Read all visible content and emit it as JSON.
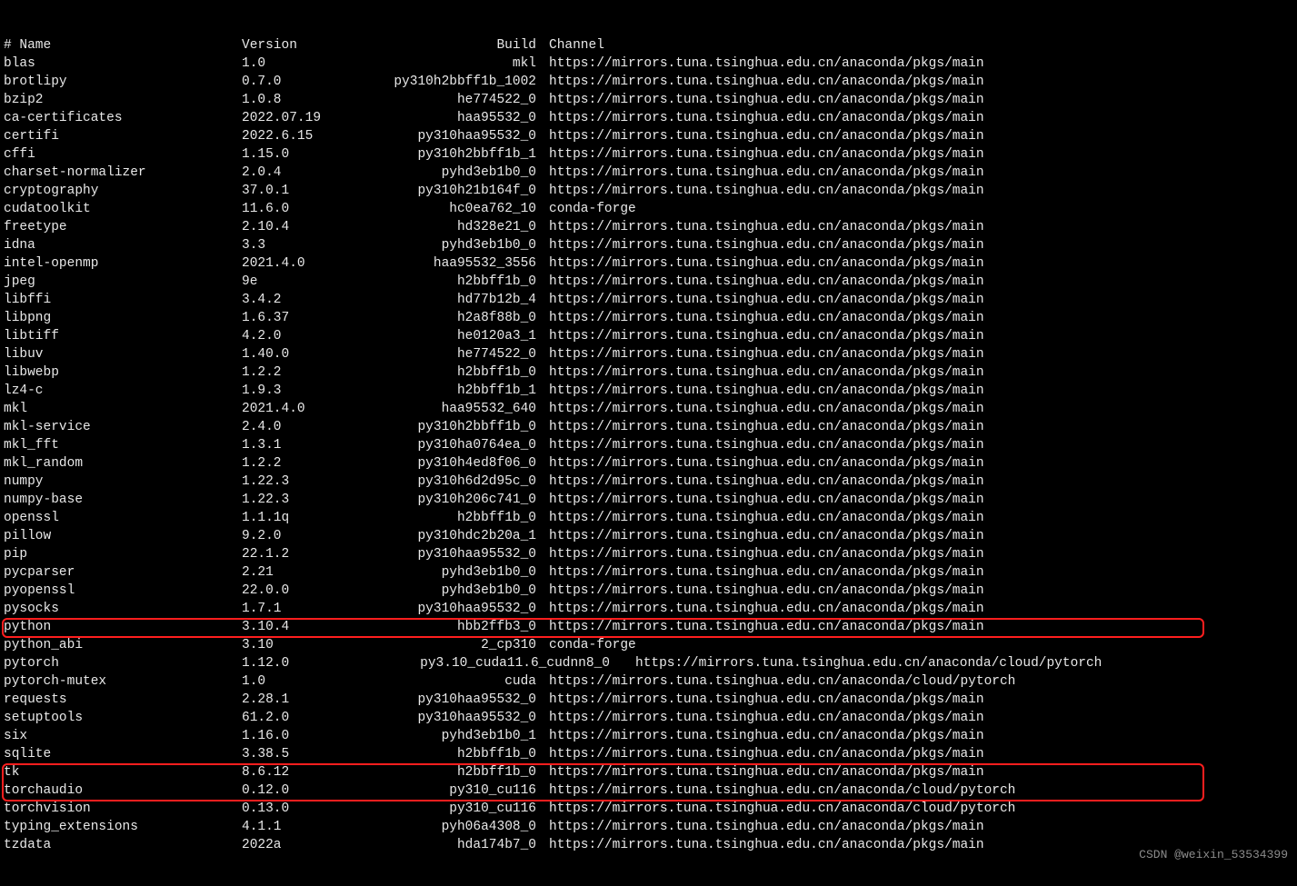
{
  "watermark": "CSDN @weixin_53534399",
  "header": {
    "name": "# Name",
    "version": "Version",
    "build": "Build",
    "channel": "Channel"
  },
  "packages": [
    {
      "name": "blas",
      "version": "1.0",
      "build": "mkl",
      "channel": "https://mirrors.tuna.tsinghua.edu.cn/anaconda/pkgs/main"
    },
    {
      "name": "brotlipy",
      "version": "0.7.0",
      "build": "py310h2bbff1b_1002",
      "channel": "https://mirrors.tuna.tsinghua.edu.cn/anaconda/pkgs/main"
    },
    {
      "name": "bzip2",
      "version": "1.0.8",
      "build": "he774522_0",
      "channel": "https://mirrors.tuna.tsinghua.edu.cn/anaconda/pkgs/main"
    },
    {
      "name": "ca-certificates",
      "version": "2022.07.19",
      "build": "haa95532_0",
      "channel": "https://mirrors.tuna.tsinghua.edu.cn/anaconda/pkgs/main"
    },
    {
      "name": "certifi",
      "version": "2022.6.15",
      "build": "py310haa95532_0",
      "channel": "https://mirrors.tuna.tsinghua.edu.cn/anaconda/pkgs/main"
    },
    {
      "name": "cffi",
      "version": "1.15.0",
      "build": "py310h2bbff1b_1",
      "channel": "https://mirrors.tuna.tsinghua.edu.cn/anaconda/pkgs/main"
    },
    {
      "name": "charset-normalizer",
      "version": "2.0.4",
      "build": "pyhd3eb1b0_0",
      "channel": "https://mirrors.tuna.tsinghua.edu.cn/anaconda/pkgs/main"
    },
    {
      "name": "cryptography",
      "version": "37.0.1",
      "build": "py310h21b164f_0",
      "channel": "https://mirrors.tuna.tsinghua.edu.cn/anaconda/pkgs/main"
    },
    {
      "name": "cudatoolkit",
      "version": "11.6.0",
      "build": "hc0ea762_10",
      "channel": "conda-forge"
    },
    {
      "name": "freetype",
      "version": "2.10.4",
      "build": "hd328e21_0",
      "channel": "https://mirrors.tuna.tsinghua.edu.cn/anaconda/pkgs/main"
    },
    {
      "name": "idna",
      "version": "3.3",
      "build": "pyhd3eb1b0_0",
      "channel": "https://mirrors.tuna.tsinghua.edu.cn/anaconda/pkgs/main"
    },
    {
      "name": "intel-openmp",
      "version": "2021.4.0",
      "build": "haa95532_3556",
      "channel": "https://mirrors.tuna.tsinghua.edu.cn/anaconda/pkgs/main"
    },
    {
      "name": "jpeg",
      "version": "9e",
      "build": "h2bbff1b_0",
      "channel": "https://mirrors.tuna.tsinghua.edu.cn/anaconda/pkgs/main"
    },
    {
      "name": "libffi",
      "version": "3.4.2",
      "build": "hd77b12b_4",
      "channel": "https://mirrors.tuna.tsinghua.edu.cn/anaconda/pkgs/main"
    },
    {
      "name": "libpng",
      "version": "1.6.37",
      "build": "h2a8f88b_0",
      "channel": "https://mirrors.tuna.tsinghua.edu.cn/anaconda/pkgs/main"
    },
    {
      "name": "libtiff",
      "version": "4.2.0",
      "build": "he0120a3_1",
      "channel": "https://mirrors.tuna.tsinghua.edu.cn/anaconda/pkgs/main"
    },
    {
      "name": "libuv",
      "version": "1.40.0",
      "build": "he774522_0",
      "channel": "https://mirrors.tuna.tsinghua.edu.cn/anaconda/pkgs/main"
    },
    {
      "name": "libwebp",
      "version": "1.2.2",
      "build": "h2bbff1b_0",
      "channel": "https://mirrors.tuna.tsinghua.edu.cn/anaconda/pkgs/main"
    },
    {
      "name": "lz4-c",
      "version": "1.9.3",
      "build": "h2bbff1b_1",
      "channel": "https://mirrors.tuna.tsinghua.edu.cn/anaconda/pkgs/main"
    },
    {
      "name": "mkl",
      "version": "2021.4.0",
      "build": "haa95532_640",
      "channel": "https://mirrors.tuna.tsinghua.edu.cn/anaconda/pkgs/main"
    },
    {
      "name": "mkl-service",
      "version": "2.4.0",
      "build": "py310h2bbff1b_0",
      "channel": "https://mirrors.tuna.tsinghua.edu.cn/anaconda/pkgs/main"
    },
    {
      "name": "mkl_fft",
      "version": "1.3.1",
      "build": "py310ha0764ea_0",
      "channel": "https://mirrors.tuna.tsinghua.edu.cn/anaconda/pkgs/main"
    },
    {
      "name": "mkl_random",
      "version": "1.2.2",
      "build": "py310h4ed8f06_0",
      "channel": "https://mirrors.tuna.tsinghua.edu.cn/anaconda/pkgs/main"
    },
    {
      "name": "numpy",
      "version": "1.22.3",
      "build": "py310h6d2d95c_0",
      "channel": "https://mirrors.tuna.tsinghua.edu.cn/anaconda/pkgs/main"
    },
    {
      "name": "numpy-base",
      "version": "1.22.3",
      "build": "py310h206c741_0",
      "channel": "https://mirrors.tuna.tsinghua.edu.cn/anaconda/pkgs/main"
    },
    {
      "name": "openssl",
      "version": "1.1.1q",
      "build": "h2bbff1b_0",
      "channel": "https://mirrors.tuna.tsinghua.edu.cn/anaconda/pkgs/main"
    },
    {
      "name": "pillow",
      "version": "9.2.0",
      "build": "py310hdc2b20a_1",
      "channel": "https://mirrors.tuna.tsinghua.edu.cn/anaconda/pkgs/main"
    },
    {
      "name": "pip",
      "version": "22.1.2",
      "build": "py310haa95532_0",
      "channel": "https://mirrors.tuna.tsinghua.edu.cn/anaconda/pkgs/main"
    },
    {
      "name": "pycparser",
      "version": "2.21",
      "build": "pyhd3eb1b0_0",
      "channel": "https://mirrors.tuna.tsinghua.edu.cn/anaconda/pkgs/main"
    },
    {
      "name": "pyopenssl",
      "version": "22.0.0",
      "build": "pyhd3eb1b0_0",
      "channel": "https://mirrors.tuna.tsinghua.edu.cn/anaconda/pkgs/main"
    },
    {
      "name": "pysocks",
      "version": "1.7.1",
      "build": "py310haa95532_0",
      "channel": "https://mirrors.tuna.tsinghua.edu.cn/anaconda/pkgs/main"
    },
    {
      "name": "python",
      "version": "3.10.4",
      "build": "hbb2ffb3_0",
      "channel": "https://mirrors.tuna.tsinghua.edu.cn/anaconda/pkgs/main"
    },
    {
      "name": "python_abi",
      "version": "3.10",
      "build": "2_cp310",
      "channel": "conda-forge"
    },
    {
      "name": "pytorch",
      "version": "1.12.0",
      "build": "py3.10_cuda11.6_cudnn8_0",
      "channel": "https://mirrors.tuna.tsinghua.edu.cn/anaconda/cloud/pytorch",
      "hl": 1,
      "pad": true
    },
    {
      "name": "pytorch-mutex",
      "version": "1.0",
      "build": "cuda",
      "channel": "https://mirrors.tuna.tsinghua.edu.cn/anaconda/cloud/pytorch"
    },
    {
      "name": "requests",
      "version": "2.28.1",
      "build": "py310haa95532_0",
      "channel": "https://mirrors.tuna.tsinghua.edu.cn/anaconda/pkgs/main"
    },
    {
      "name": "setuptools",
      "version": "61.2.0",
      "build": "py310haa95532_0",
      "channel": "https://mirrors.tuna.tsinghua.edu.cn/anaconda/pkgs/main"
    },
    {
      "name": "six",
      "version": "1.16.0",
      "build": "pyhd3eb1b0_1",
      "channel": "https://mirrors.tuna.tsinghua.edu.cn/anaconda/pkgs/main"
    },
    {
      "name": "sqlite",
      "version": "3.38.5",
      "build": "h2bbff1b_0",
      "channel": "https://mirrors.tuna.tsinghua.edu.cn/anaconda/pkgs/main"
    },
    {
      "name": "tk",
      "version": "8.6.12",
      "build": "h2bbff1b_0",
      "channel": "https://mirrors.tuna.tsinghua.edu.cn/anaconda/pkgs/main"
    },
    {
      "name": "torchaudio",
      "version": "0.12.0",
      "build": "py310_cu116",
      "channel": "https://mirrors.tuna.tsinghua.edu.cn/anaconda/cloud/pytorch",
      "hl": 2
    },
    {
      "name": "torchvision",
      "version": "0.13.0",
      "build": "py310_cu116",
      "channel": "https://mirrors.tuna.tsinghua.edu.cn/anaconda/cloud/pytorch",
      "hl": 2
    },
    {
      "name": "typing_extensions",
      "version": "4.1.1",
      "build": "pyh06a4308_0",
      "channel": "https://mirrors.tuna.tsinghua.edu.cn/anaconda/pkgs/main"
    },
    {
      "name": "tzdata",
      "version": "2022a",
      "build": "hda174b7_0",
      "channel": "https://mirrors.tuna.tsinghua.edu.cn/anaconda/pkgs/main"
    }
  ]
}
